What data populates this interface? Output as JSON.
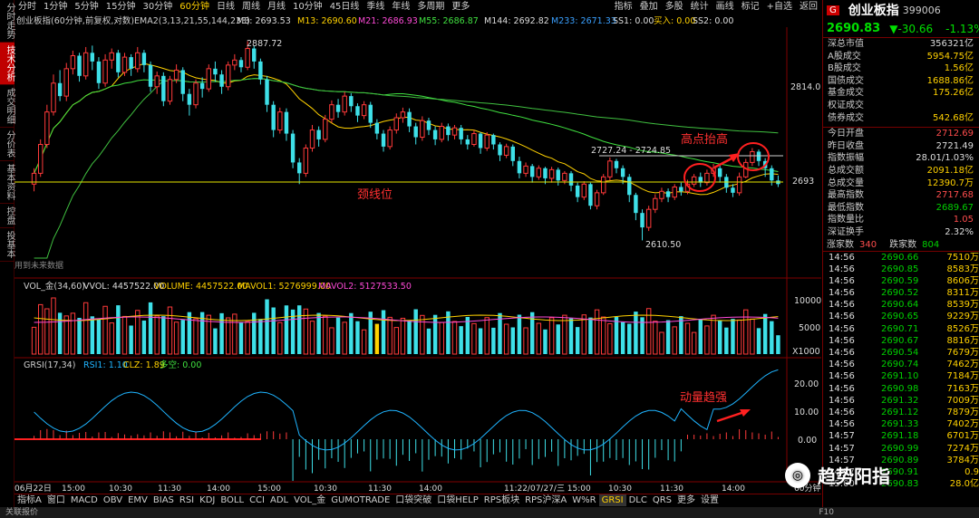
{
  "vtabs": [
    "分时走势",
    "技术分析",
    "成交明细",
    "分价表",
    "基本资料",
    "控盘",
    "投基本"
  ],
  "toolbar": {
    "periods": [
      "分时",
      "1分钟",
      "5分钟",
      "15分钟",
      "30分钟",
      "60分钟",
      "日线",
      "周线",
      "月线",
      "10分钟",
      "45日线",
      "季线",
      "年线",
      "多周期",
      "更多"
    ],
    "active_period": "60分钟",
    "right": [
      "指标",
      "叠加",
      "多股",
      "统计",
      "画线",
      "标记",
      "+自选",
      "返回"
    ]
  },
  "main_legend": {
    "title": "创业板指(60分钟,前复权,对数)",
    "ema_label": "EMA2(3,13,21,55,144,233)",
    "m3": "M3: 2693.53",
    "m13": "M13: 2690.60",
    "m21": "M21: 2686.93",
    "m55": "M55: 2686.87",
    "m144": "M144: 2692.82",
    "m233": "M233: 2671.33",
    "ss1": "SS1: 0.00",
    "buy": "买入: 0.00",
    "ss2": "SS2: 0.00"
  },
  "annotations": {
    "high": "2887.72",
    "low": "2610.50",
    "range": "2727.24 - 2724.85",
    "neckline": "颈线位",
    "higher_high": "高点抬高",
    "momentum": "动量趋强",
    "no_future": "用到未来数据"
  },
  "price_axis": [
    "2814.0",
    "2693"
  ],
  "vol_legend": {
    "title": "VOL_金(34,60)",
    "vvol": "VVOL: 4457522.00",
    "volume": "VOLUME: 4457522.00",
    "mavol1": "MAVOL1: 5276999.00",
    "mavol2": "MAVOL2: 5127533.50"
  },
  "vol_axis": [
    "10000",
    "5000",
    "X1000"
  ],
  "grsi_legend": {
    "title": "GRSI(17,34)",
    "rsi1": "RSI1: 1.10",
    "clz": "CLZ: 1.89",
    "duoying": "多空: 0.00"
  },
  "grsi_axis": [
    "20.00",
    "10.00",
    "0.00"
  ],
  "time_axis": [
    "06月22日",
    "15:00",
    "10:30",
    "11:30",
    "14:00",
    "15:00",
    "10:30",
    "11:30",
    "14:00",
    "11:22/07/27/三 15:00",
    "10:30",
    "11:30",
    "14:00",
    "60分钟"
  ],
  "bottom_tabs": [
    "指标A",
    "窗口",
    "MACD",
    "OBV",
    "EMV",
    "BIAS",
    "RSI",
    "KDJ",
    "BOLL",
    "CCI",
    "ADL",
    "VOL_金",
    "GUMOTRADE",
    "口袋突破",
    "口袋HELP",
    "RPS板块",
    "RPS沪深A",
    "W%R",
    "GRSI",
    "DLC",
    "QRS",
    "更多",
    "设置"
  ],
  "active_bottom_tab": "GRSI",
  "status_left": "关联报价",
  "status_right": "F10",
  "panel": {
    "g": "G",
    "name": "创业板指",
    "code": "399006",
    "price": "2690.83",
    "change": "▼-30.66",
    "pct": "-1.13%",
    "stats_a": [
      {
        "k": "深总市值",
        "v": "356321亿",
        "c": "white"
      },
      {
        "k": "A股成交",
        "v": "5954.75亿",
        "c": "yellow"
      },
      {
        "k": "B股成交",
        "v": "1.56亿",
        "c": "yellow"
      },
      {
        "k": "国债成交",
        "v": "1688.86亿",
        "c": "yellow"
      },
      {
        "k": "基金成交",
        "v": "175.26亿",
        "c": "yellow"
      },
      {
        "k": "权证成交",
        "v": "",
        "c": "yellow"
      },
      {
        "k": "债券成交",
        "v": "542.68亿",
        "c": "yellow"
      }
    ],
    "stats_b": [
      {
        "k": "今日开盘",
        "v": "2712.69",
        "c": "red"
      },
      {
        "k": "昨日收盘",
        "v": "2721.49",
        "c": "white"
      },
      {
        "k": "指数振幅",
        "v": "28.01/1.03%",
        "c": "white"
      },
      {
        "k": "总成交额",
        "v": "2091.18亿",
        "c": "yellow"
      },
      {
        "k": "总成交量",
        "v": "12390.7万",
        "c": "yellow"
      },
      {
        "k": "最高指数",
        "v": "2717.68",
        "c": "red"
      },
      {
        "k": "最低指数",
        "v": "2689.67",
        "c": "green"
      },
      {
        "k": "指数量比",
        "v": "1.05",
        "c": "red"
      },
      {
        "k": "深证换手",
        "v": "2.32%",
        "c": "white"
      }
    ],
    "up_label": "涨家数",
    "up": "340",
    "down_label": "跌家数",
    "down": "804",
    "ticks": [
      {
        "t": "14:56",
        "p": "2690.66",
        "v": "7510万"
      },
      {
        "t": "14:56",
        "p": "2690.85",
        "v": "8583万"
      },
      {
        "t": "14:56",
        "p": "2690.59",
        "v": "8606万"
      },
      {
        "t": "14:56",
        "p": "2690.52",
        "v": "8311万"
      },
      {
        "t": "14:56",
        "p": "2690.64",
        "v": "8539万"
      },
      {
        "t": "14:56",
        "p": "2690.65",
        "v": "9229万"
      },
      {
        "t": "14:56",
        "p": "2690.71",
        "v": "8526万"
      },
      {
        "t": "14:56",
        "p": "2690.67",
        "v": "8816万"
      },
      {
        "t": "14:56",
        "p": "2690.54",
        "v": "7679万"
      },
      {
        "t": "14:56",
        "p": "2690.74",
        "v": "7462万"
      },
      {
        "t": "14:56",
        "p": "2691.10",
        "v": "7184万"
      },
      {
        "t": "14:56",
        "p": "2690.98",
        "v": "7163万"
      },
      {
        "t": "14:56",
        "p": "2691.32",
        "v": "7009万"
      },
      {
        "t": "14:56",
        "p": "2691.12",
        "v": "7879万"
      },
      {
        "t": "14:56",
        "p": "2691.33",
        "v": "7402万"
      },
      {
        "t": "14:57",
        "p": "2691.18",
        "v": "6701万"
      },
      {
        "t": "14:57",
        "p": "2690.99",
        "v": "7274万"
      },
      {
        "t": "14:57",
        "p": "2690.89",
        "v": "3784万"
      },
      {
        "t": "14:57",
        "p": "2690.91",
        "v": "0.9"
      },
      {
        "t": "15:00",
        "p": "2690.83",
        "v": "28.0亿"
      }
    ]
  },
  "watermark": "趋势阳指",
  "chart_data": {
    "type": "candlestick",
    "candles": [
      [
        2690,
        2705,
        2680,
        2712
      ],
      [
        2705,
        2745,
        2700,
        2752
      ],
      [
        2745,
        2790,
        2740,
        2800
      ],
      [
        2790,
        2830,
        2785,
        2842
      ],
      [
        2830,
        2812,
        2805,
        2848
      ],
      [
        2812,
        2850,
        2805,
        2858
      ],
      [
        2850,
        2868,
        2842,
        2875
      ],
      [
        2868,
        2840,
        2832,
        2872
      ],
      [
        2840,
        2872,
        2835,
        2880
      ],
      [
        2872,
        2860,
        2848,
        2882
      ],
      [
        2860,
        2830,
        2822,
        2866
      ],
      [
        2830,
        2862,
        2825,
        2870
      ],
      [
        2862,
        2872,
        2850,
        2878
      ],
      [
        2872,
        2845,
        2838,
        2876
      ],
      [
        2845,
        2866,
        2840,
        2872
      ],
      [
        2866,
        2850,
        2840,
        2870
      ],
      [
        2850,
        2872,
        2845,
        2880
      ],
      [
        2872,
        2855,
        2845,
        2876
      ],
      [
        2855,
        2825,
        2818,
        2860
      ],
      [
        2825,
        2840,
        2815,
        2846
      ],
      [
        2840,
        2805,
        2798,
        2845
      ],
      [
        2805,
        2835,
        2800,
        2840
      ],
      [
        2835,
        2848,
        2830,
        2856
      ],
      [
        2848,
        2815,
        2805,
        2852
      ],
      [
        2815,
        2800,
        2785,
        2822
      ],
      [
        2800,
        2830,
        2795,
        2835
      ],
      [
        2830,
        2822,
        2810,
        2838
      ],
      [
        2822,
        2850,
        2818,
        2856
      ],
      [
        2850,
        2842,
        2832,
        2860
      ],
      [
        2842,
        2825,
        2815,
        2848
      ],
      [
        2825,
        2855,
        2820,
        2860
      ],
      [
        2855,
        2862,
        2848,
        2870
      ],
      [
        2862,
        2852,
        2845,
        2866
      ],
      [
        2852,
        2878,
        2848,
        2888
      ],
      [
        2878,
        2860,
        2850,
        2882
      ],
      [
        2860,
        2835,
        2828,
        2864
      ],
      [
        2835,
        2800,
        2790,
        2840
      ],
      [
        2800,
        2765,
        2755,
        2805
      ],
      [
        2765,
        2790,
        2760,
        2796
      ],
      [
        2790,
        2760,
        2750,
        2795
      ],
      [
        2760,
        2720,
        2712,
        2765
      ],
      [
        2720,
        2705,
        2690,
        2726
      ],
      [
        2705,
        2740,
        2700,
        2745
      ],
      [
        2740,
        2765,
        2735,
        2772
      ],
      [
        2765,
        2752,
        2742,
        2770
      ],
      [
        2752,
        2780,
        2748,
        2786
      ],
      [
        2780,
        2800,
        2775,
        2806
      ],
      [
        2800,
        2790,
        2782,
        2808
      ],
      [
        2790,
        2812,
        2785,
        2818
      ],
      [
        2812,
        2798,
        2790,
        2816
      ],
      [
        2798,
        2785,
        2776,
        2802
      ],
      [
        2785,
        2800,
        2780,
        2805
      ],
      [
        2800,
        2775,
        2768,
        2804
      ],
      [
        2775,
        2760,
        2752,
        2780
      ],
      [
        2760,
        2742,
        2735,
        2765
      ],
      [
        2742,
        2765,
        2738,
        2770
      ],
      [
        2765,
        2782,
        2760,
        2788
      ],
      [
        2782,
        2790,
        2775,
        2796
      ],
      [
        2790,
        2770,
        2762,
        2795
      ],
      [
        2770,
        2755,
        2745,
        2775
      ],
      [
        2755,
        2778,
        2750,
        2784
      ],
      [
        2778,
        2765,
        2758,
        2782
      ],
      [
        2765,
        2752,
        2744,
        2770
      ],
      [
        2752,
        2770,
        2748,
        2775
      ],
      [
        2770,
        2758,
        2750,
        2774
      ],
      [
        2758,
        2768,
        2752,
        2772
      ],
      [
        2768,
        2752,
        2745,
        2772
      ],
      [
        2752,
        2745,
        2738,
        2758
      ],
      [
        2745,
        2760,
        2742,
        2765
      ],
      [
        2760,
        2740,
        2732,
        2762
      ],
      [
        2740,
        2758,
        2736,
        2762
      ],
      [
        2758,
        2745,
        2738,
        2760
      ],
      [
        2745,
        2730,
        2722,
        2748
      ],
      [
        2730,
        2742,
        2726,
        2746
      ],
      [
        2742,
        2722,
        2715,
        2745
      ],
      [
        2722,
        2705,
        2698,
        2728
      ],
      [
        2705,
        2715,
        2700,
        2720
      ],
      [
        2715,
        2700,
        2692,
        2718
      ],
      [
        2700,
        2712,
        2696,
        2716
      ],
      [
        2712,
        2698,
        2690,
        2714
      ],
      [
        2698,
        2710,
        2692,
        2714
      ],
      [
        2710,
        2695,
        2688,
        2713
      ],
      [
        2695,
        2705,
        2690,
        2708
      ],
      [
        2705,
        2688,
        2680,
        2708
      ],
      [
        2688,
        2672,
        2665,
        2692
      ],
      [
        2672,
        2690,
        2668,
        2694
      ],
      [
        2690,
        2660,
        2655,
        2692
      ],
      [
        2660,
        2678,
        2655,
        2682
      ],
      [
        2678,
        2700,
        2675,
        2704
      ],
      [
        2700,
        2722,
        2695,
        2727
      ],
      [
        2722,
        2712,
        2705,
        2725
      ],
      [
        2712,
        2700,
        2690,
        2716
      ],
      [
        2700,
        2675,
        2665,
        2704
      ],
      [
        2675,
        2650,
        2640,
        2678
      ],
      [
        2650,
        2630,
        2612,
        2655
      ],
      [
        2630,
        2655,
        2625,
        2660
      ],
      [
        2655,
        2670,
        2650,
        2676
      ],
      [
        2670,
        2680,
        2665,
        2685
      ],
      [
        2680,
        2672,
        2665,
        2684
      ],
      [
        2672,
        2686,
        2668,
        2690
      ],
      [
        2686,
        2680,
        2674,
        2692
      ],
      [
        2680,
        2690,
        2676,
        2696
      ],
      [
        2690,
        2700,
        2686,
        2704
      ],
      [
        2700,
        2692,
        2686,
        2706
      ],
      [
        2692,
        2705,
        2688,
        2710
      ],
      [
        2705,
        2712,
        2700,
        2718
      ],
      [
        2712,
        2700,
        2692,
        2716
      ],
      [
        2700,
        2685,
        2678,
        2704
      ],
      [
        2685,
        2678,
        2672,
        2690
      ],
      [
        2678,
        2700,
        2674,
        2706
      ],
      [
        2700,
        2720,
        2698,
        2725
      ],
      [
        2720,
        2735,
        2715,
        2740
      ],
      [
        2735,
        2722,
        2715,
        2738
      ],
      [
        2722,
        2712,
        2700,
        2726
      ],
      [
        2712,
        2695,
        2688,
        2716
      ],
      [
        2695,
        2690,
        2686,
        2702
      ]
    ]
  }
}
